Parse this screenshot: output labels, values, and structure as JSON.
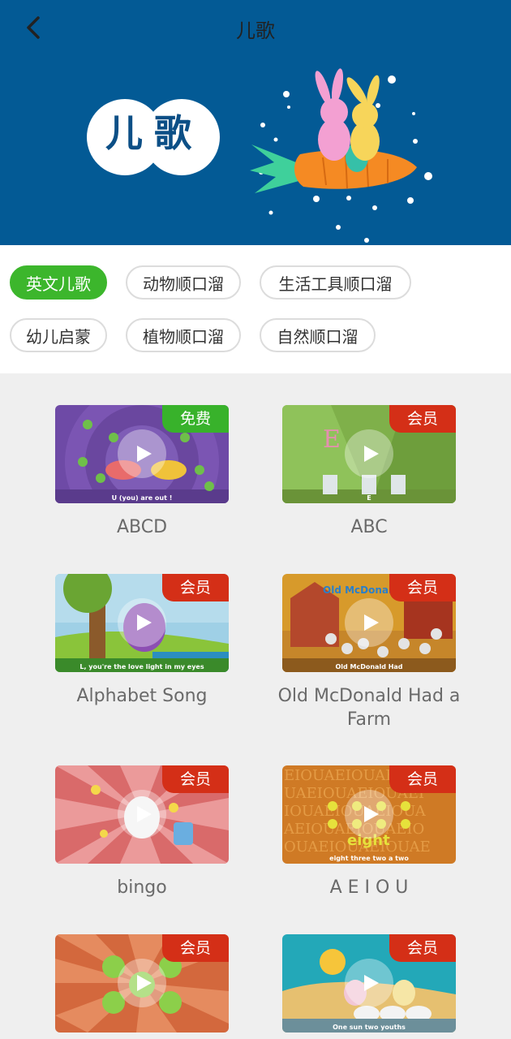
{
  "header": {
    "title": "儿歌",
    "badge": "儿歌"
  },
  "categories": [
    {
      "label": "英文儿歌",
      "active": true
    },
    {
      "label": "动物顺口溜",
      "active": false
    },
    {
      "label": "生活工具顺口溜",
      "active": false
    },
    {
      "label": "幼儿启蒙",
      "active": false
    },
    {
      "label": "植物顺口溜",
      "active": false
    },
    {
      "label": "自然顺口溜",
      "active": false
    }
  ],
  "songs": [
    {
      "title": "ABCD",
      "tag": "免费",
      "caption": "U (you) are out !"
    },
    {
      "title": "ABC",
      "tag": "会员",
      "caption": "E"
    },
    {
      "title": "Alphabet Song",
      "tag": "会员",
      "caption": "L, you're the love light in my eyes"
    },
    {
      "title": "Old McDonald Had a Farm",
      "tag": "会员",
      "caption": "Old McDonald Had"
    },
    {
      "title": "bingo",
      "tag": "会员",
      "caption": ""
    },
    {
      "title": "A E I O U",
      "tag": "会员",
      "caption": "eight three two a two"
    },
    {
      "title": "",
      "tag": "会员",
      "caption": ""
    },
    {
      "title": "",
      "tag": "会员",
      "caption": "One sun two youths"
    }
  ],
  "colors": {
    "accent": "#3cb62c",
    "vip": "#d42f17",
    "banner": "#035a95"
  }
}
